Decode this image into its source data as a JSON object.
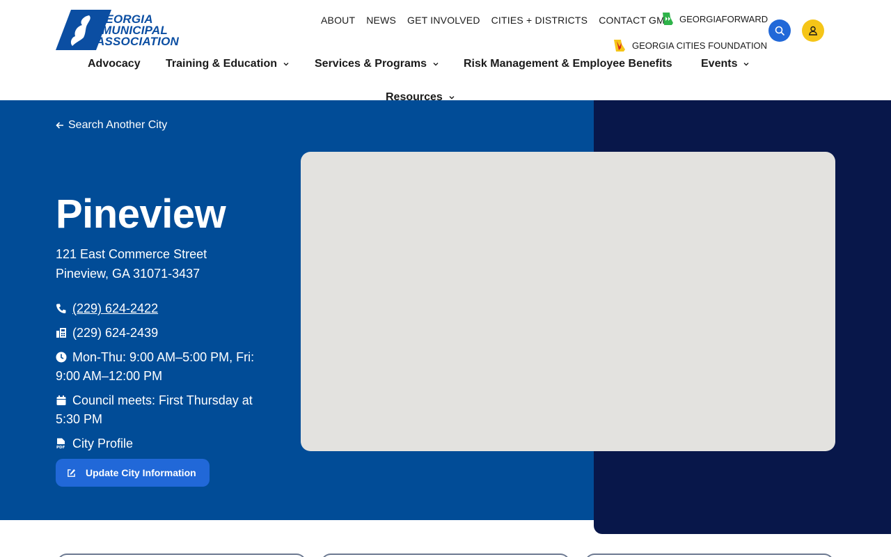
{
  "header": {
    "logo": {
      "line1": "GEORGIA",
      "line2": "MUNICIPAL",
      "line3": "ASSOCIATION"
    },
    "utility_nav": [
      "ABOUT",
      "NEWS",
      "GET INVOLVED",
      "CITIES + DISTRICTS",
      "CONTACT GMA"
    ],
    "georgia_forward": "GEORGIAFORWARD",
    "cities_foundation": "GEORGIA CITIES FOUNDATION",
    "search_icon": "search-icon",
    "account_icon": "user-icon",
    "main_nav": {
      "advocacy": "Advocacy",
      "training": "Training & Education",
      "services": "Services & Programs",
      "risk": "Risk Management & Employee Benefits",
      "events": "Events",
      "resources": "Resources"
    }
  },
  "hero": {
    "back_link": "Search Another City",
    "city_name": "Pineview",
    "address_line1": "121 East Commerce Street",
    "address_line2": "Pineview, GA 31071-3437",
    "phone": "(229) 624-2422",
    "fax": "(229) 624-2439",
    "hours": "Mon-Thu: 9:00 AM–5:00 PM, Fri: 9:00 AM–12:00 PM",
    "council": "Council meets: First Thursday at 5:30 PM",
    "profile": "City Profile",
    "update_button": "Update City Information"
  },
  "colors": {
    "primary_blue": "#014c97",
    "navy": "#08174a",
    "button_blue": "#2168d8",
    "accent_yellow": "#f5c518",
    "map_gray": "#e3e2df"
  }
}
